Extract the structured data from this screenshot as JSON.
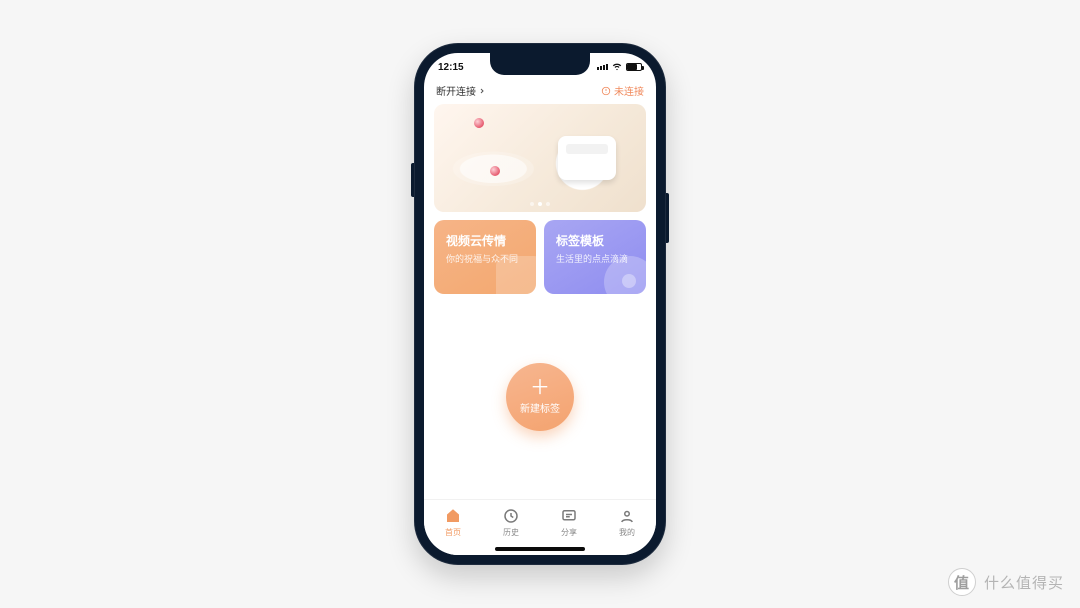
{
  "statusbar": {
    "time": "12:15"
  },
  "header": {
    "connection_label": "断开连接",
    "status_label": "未连接"
  },
  "hero": {
    "dot_count": 3,
    "active_dot": 2
  },
  "cards": {
    "left": {
      "title": "视频云传情",
      "subtitle": "你的祝福与众不同"
    },
    "right": {
      "title": "标签模板",
      "subtitle": "生活里的点点滴滴"
    }
  },
  "fab": {
    "label": "新建标签"
  },
  "tabs": {
    "items": [
      {
        "label": "首页"
      },
      {
        "label": "历史"
      },
      {
        "label": "分享"
      },
      {
        "label": "我的"
      }
    ],
    "active_index": 0
  },
  "watermark": {
    "badge": "值",
    "text": "什么值得买"
  }
}
